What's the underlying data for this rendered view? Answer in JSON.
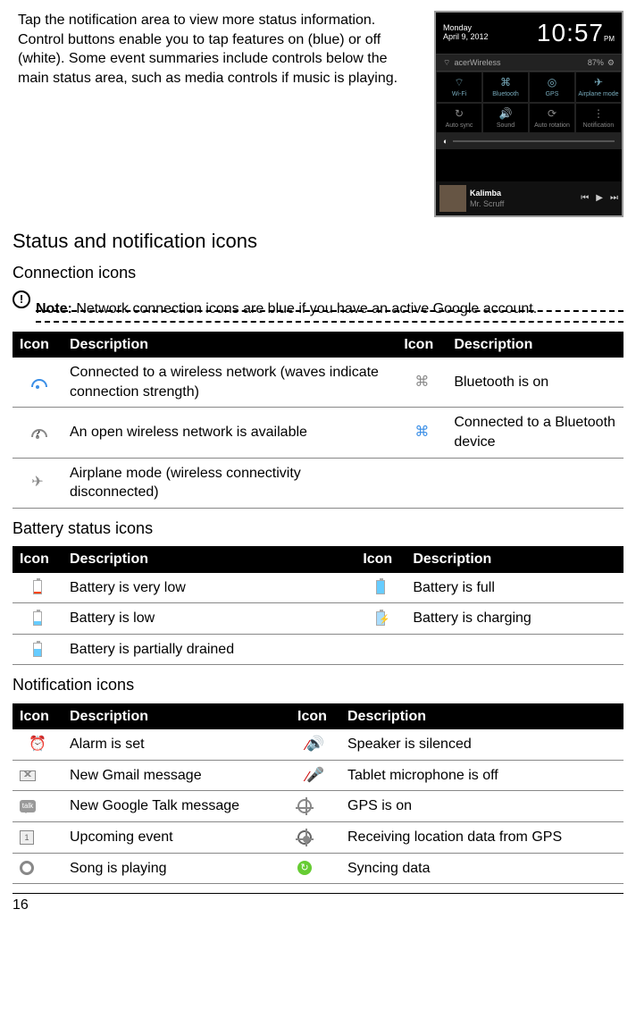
{
  "intro": "Tap the notification area to view more status information. Control buttons enable you to tap features on (blue) or off (white). Some event summaries include controls below the main status area, such as media controls if music is playing.",
  "heading1": "Status and notification icons",
  "section_connection": "Connection icons",
  "note_label": "Note:",
  "note_text": " Network connection icons are blue if you have an active Google account.",
  "section_battery": "Battery status icons",
  "section_notification": "Notification icons",
  "th_icon": "Icon",
  "th_desc": "Description",
  "connection_rows": [
    {
      "d1": "Connected to a wireless network (waves indicate connection strength)",
      "d2": "Bluetooth is on"
    },
    {
      "d1": "An open wireless network is available",
      "d2": "Connected to a Bluetooth device"
    },
    {
      "d1": "Airplane mode (wireless connectivity disconnected)",
      "d2": ""
    }
  ],
  "battery_rows": [
    {
      "d1": "Battery is very low",
      "d2": "Battery is full"
    },
    {
      "d1": "Battery is low",
      "d2": "Battery is charging"
    },
    {
      "d1": "Battery is partially drained",
      "d2": ""
    }
  ],
  "notification_rows": [
    {
      "d1": "Alarm is set",
      "d2": "Speaker is silenced"
    },
    {
      "d1": "New Gmail message",
      "d2": "Tablet microphone is off"
    },
    {
      "d1": "New Google Talk message",
      "d2": "GPS is on"
    },
    {
      "d1": "Upcoming event",
      "d2": "Receiving location data from GPS"
    },
    {
      "d1": "Song is playing",
      "d2": "Syncing data"
    }
  ],
  "screenshot": {
    "day": "Monday",
    "date": "April 9, 2012",
    "time": "10:57",
    "ampm": "PM",
    "wifi": "acerWireless",
    "battery": "87%",
    "tiles1": [
      "Wi-Fi",
      "Bluetooth",
      "GPS",
      "Airplane mode"
    ],
    "tiles2": [
      "Auto sync",
      "Sound",
      "Auto rotation",
      "Notification"
    ],
    "track": "Kalimba",
    "artist": "Mr. Scruff"
  },
  "page": "16"
}
